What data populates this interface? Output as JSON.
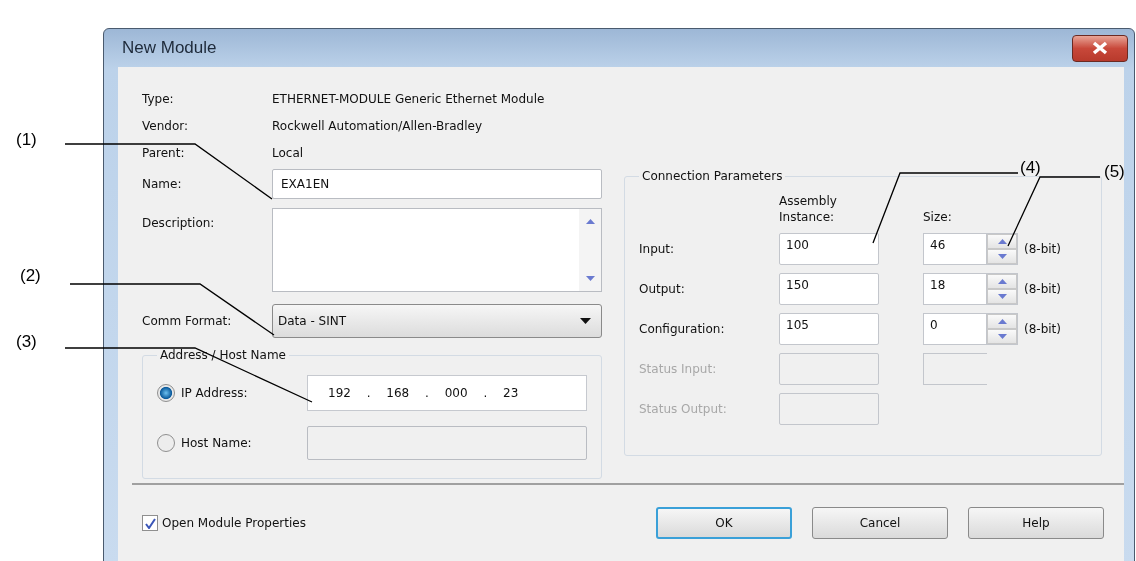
{
  "window": {
    "title": "New Module"
  },
  "info": [
    {
      "label": "Type:",
      "value": "ETHERNET-MODULE Generic Ethernet Module"
    },
    {
      "label": "Vendor:",
      "value": "Rockwell Automation/Allen-Bradley"
    },
    {
      "label": "Parent:",
      "value": "Local"
    }
  ],
  "name": {
    "label": "Name:",
    "value": "EXA1EN"
  },
  "description": {
    "label": "Description:"
  },
  "comm_format": {
    "label": "Comm Format:",
    "value": "Data - SINT"
  },
  "address": {
    "title": "Address / Host Name",
    "options": [
      {
        "label": "IP Address:",
        "selected": true,
        "value": "192 . 168 . 000 . 23"
      },
      {
        "label": "Host Name:",
        "selected": false
      }
    ]
  },
  "connection": {
    "title": "Connection Parameters",
    "headers": [
      "Assembly\nInstance:",
      "Size:"
    ],
    "rows": [
      {
        "label": "Input:",
        "disabled": false,
        "assembly": "100",
        "size": "46",
        "unit": "(8-bit)",
        "size_box": true
      },
      {
        "label": "Output:",
        "disabled": false,
        "assembly": "150",
        "size": "18",
        "unit": "(8-bit)",
        "size_box": true
      },
      {
        "label": "Configuration:",
        "disabled": false,
        "assembly": "105",
        "size": "0",
        "unit": "(8-bit)",
        "size_box": true
      },
      {
        "label": "Status Input:",
        "disabled": true,
        "size_box": true
      },
      {
        "label": "Status Output:",
        "disabled": true,
        "size_box": false
      }
    ]
  },
  "open_properties": {
    "label": "Open Module Properties",
    "checked": true
  },
  "buttons": [
    {
      "label": "OK",
      "default": true
    },
    {
      "label": "Cancel",
      "default": false
    },
    {
      "label": "Help",
      "default": false
    }
  ],
  "callouts": [
    "(1)",
    "(2)",
    "(3)",
    "(4)",
    "(5)"
  ]
}
